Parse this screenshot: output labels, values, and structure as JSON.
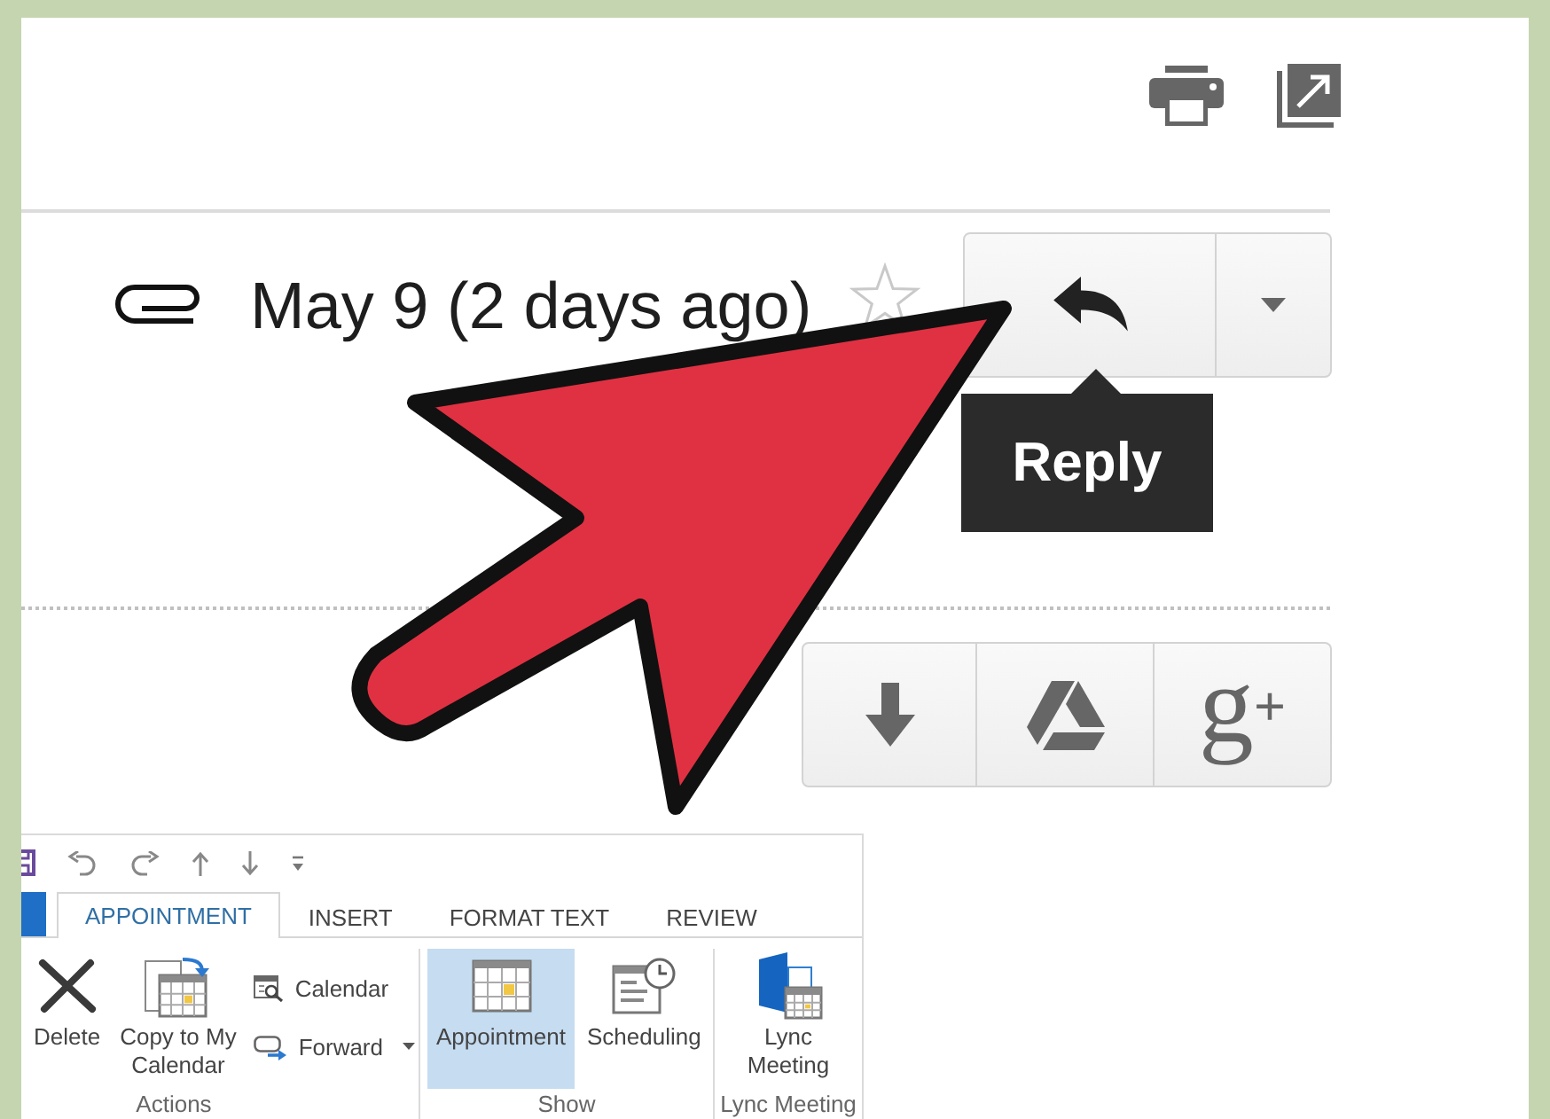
{
  "message": {
    "date": "May 9 (2 days ago)",
    "starred": false
  },
  "reply_tooltip": {
    "text": "Reply"
  },
  "attachment_actions": {
    "text_button": "g$^{+}$"
  },
  "ribbon": {
    "tabs": [
      {
        "label": "APPOINTMENT",
        "selected": true
      },
      {
        "label": "INSERT",
        "selected": false
      },
      {
        "label": "FORMAT TEXT",
        "selected": false
      },
      {
        "label": "REVIEW",
        "selected": false
      }
    ],
    "groups": [
      {
        "label": "Actions",
        "commands": [
          {
            "kind": "large",
            "label": "Delete",
            "dropdown": false
          },
          {
            "kind": "large",
            "label": "Copy to My Calendar",
            "dropdown": false
          },
          {
            "kind": "small",
            "label": "Calendar",
            "dropdown": false
          },
          {
            "kind": "small",
            "label": "Forward",
            "dropdown": true
          }
        ]
      },
      {
        "label": "Show",
        "commands": [
          {
            "kind": "large",
            "label": "Appointment",
            "selected": true
          },
          {
            "kind": "large",
            "label": "Scheduling",
            "selected": false
          }
        ]
      },
      {
        "label": "Lync Meeting",
        "commands": [
          {
            "kind": "large",
            "label": "Lync Meeting"
          }
        ]
      }
    ]
  }
}
